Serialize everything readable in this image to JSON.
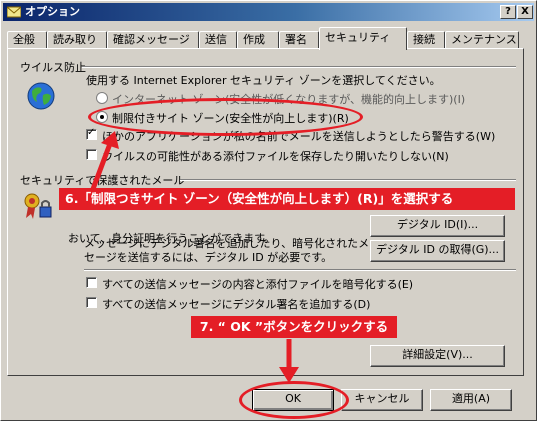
{
  "window": {
    "title": "オプション",
    "help_label": "?",
    "close_label": "X"
  },
  "tabs": [
    {
      "label": "全般"
    },
    {
      "label": "読み取り"
    },
    {
      "label": "確認メッセージ"
    },
    {
      "label": "送信"
    },
    {
      "label": "作成"
    },
    {
      "label": "署名"
    },
    {
      "label": "セキュリティ"
    },
    {
      "label": "接続"
    },
    {
      "label": "メンテナンス"
    }
  ],
  "virus": {
    "heading": "ウイルス防止",
    "description": "使用する Internet Explorer セキュリティ ゾーンを選択してください。",
    "zone_internet": "インターネット ゾーン(安全性が低くなりますが、機能的向上します)(I)",
    "zone_restricted": "制限付きサイト ゾーン(安全性が向上します)(R)",
    "warn_send": "ほかのアプリケーションが私の名前でメールを送信しようとしたら警告する(W)",
    "block_attach": "ウイルスの可能性がある添付ファイルを保存したり開いたりしない(N)"
  },
  "secure_mail": {
    "heading": "セキュリティで保護されたメール",
    "id_text": "おいて、身分証明を行うことができます。",
    "digital_id_button": "デジタル ID(I)...",
    "info_text_1": "メッセージにデジタル署名を追加したり、暗号化されたメッ",
    "info_text_2": "セージを送信するには、デジタル ID が必要です。",
    "get_id_button": "デジタル ID の取得(G)...",
    "encrypt_all": "すべての送信メッセージの内容と添付ファイルを暗号化する(E)",
    "sign_all": "すべての送信メッセージにデジタル署名を追加する(D)",
    "advanced_button": "詳細設定(V)..."
  },
  "footer": {
    "ok": "OK",
    "cancel": "キャンセル",
    "apply": "適用(A)"
  },
  "annotations": {
    "step6": "6.「制限つきサイト ゾーン（安全性が向上します）(R)」を選択する",
    "step7": "7. “ OK ”ボタンをクリックする"
  },
  "colors": {
    "annotation_red": "#e41e26",
    "title_bar_start": "#0a246a",
    "dialog_face": "#d4d0c8"
  }
}
